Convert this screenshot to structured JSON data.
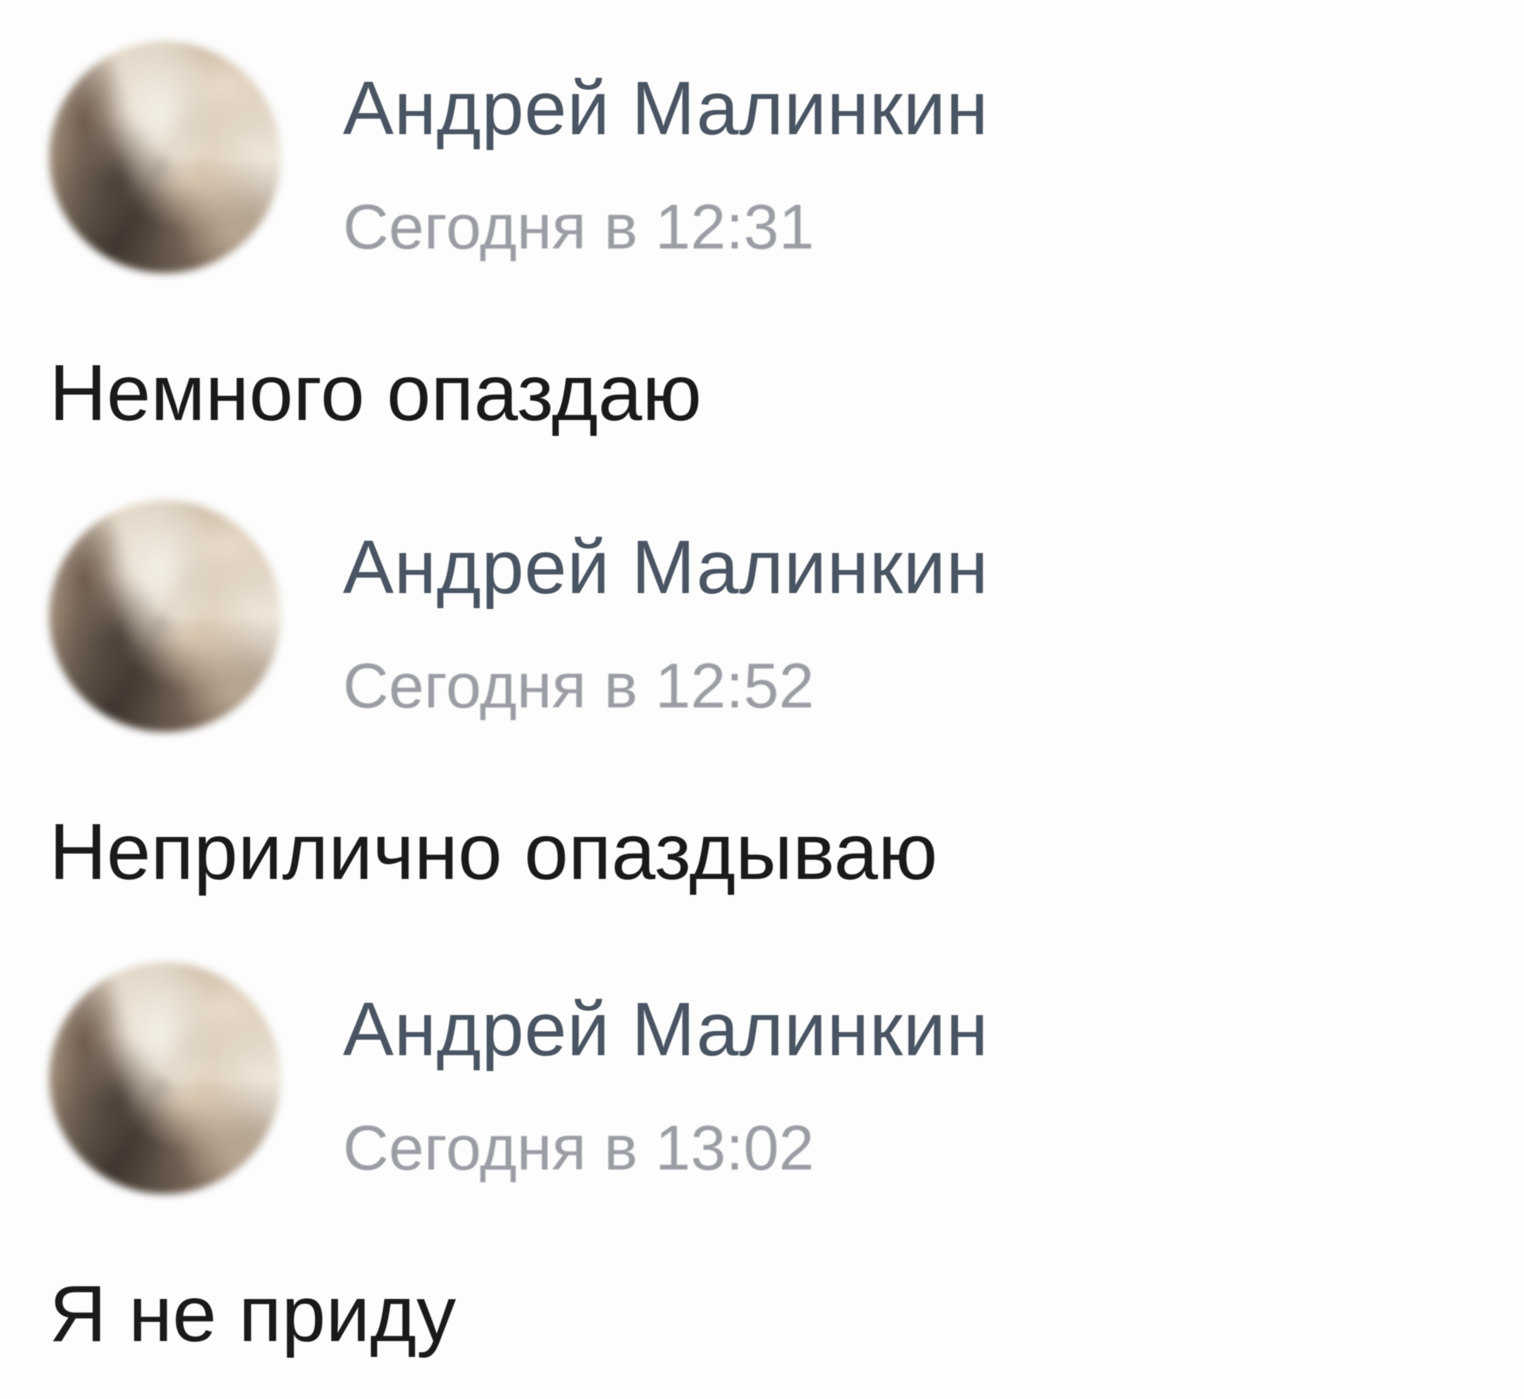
{
  "messages": [
    {
      "author": "Андрей Малинкин",
      "time": "Сегодня в 12:31",
      "text": "Немного опаздаю"
    },
    {
      "author": "Андрей Малинкин",
      "time": "Сегодня в 12:52",
      "text": "Неприлично опаздываю"
    },
    {
      "author": "Андрей Малинкин",
      "time": "Сегодня в 13:02",
      "text": "Я не приду"
    }
  ]
}
